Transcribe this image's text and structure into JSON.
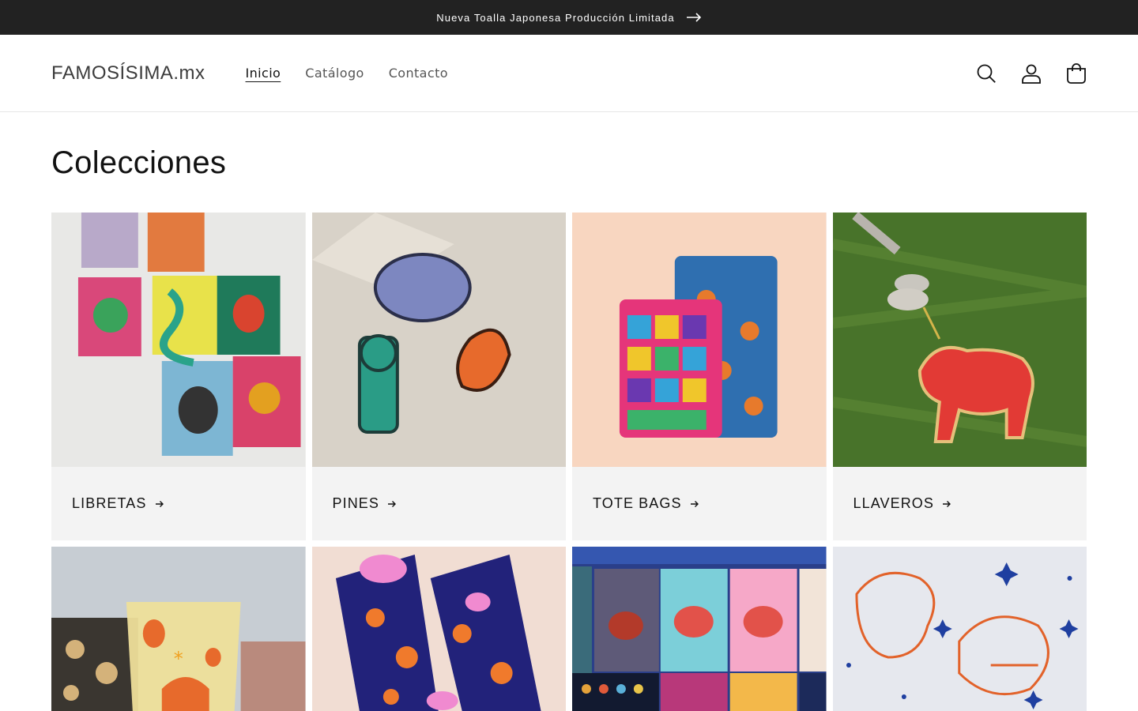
{
  "announcement": {
    "text": "Nueva Toalla Japonesa Producción Limitada",
    "icon": "arrow-right-icon"
  },
  "header": {
    "logo": "FAMOSÍSIMA.mx",
    "nav": [
      {
        "label": "Inicio",
        "active": true
      },
      {
        "label": "Catálogo",
        "active": false
      },
      {
        "label": "Contacto",
        "active": false
      }
    ],
    "icons": [
      "search-icon",
      "account-icon",
      "cart-icon"
    ]
  },
  "main": {
    "title": "Colecciones",
    "collections": [
      {
        "label": "LIBRETAS",
        "image": "notebooks-photo"
      },
      {
        "label": "PINES",
        "image": "pins-photo"
      },
      {
        "label": "TOTE BAGS",
        "image": "tote-bags-photo"
      },
      {
        "label": "LLAVEROS",
        "image": "keychain-photo"
      },
      {
        "label": "",
        "image": "glass-photo"
      },
      {
        "label": "",
        "image": "socks-photo"
      },
      {
        "label": "",
        "image": "cards-photo"
      },
      {
        "label": "",
        "image": "fabric-print-photo"
      }
    ]
  },
  "colors": {
    "announce_bg": "#222222",
    "card_bg": "#f3f3f3",
    "text": "#121212"
  }
}
